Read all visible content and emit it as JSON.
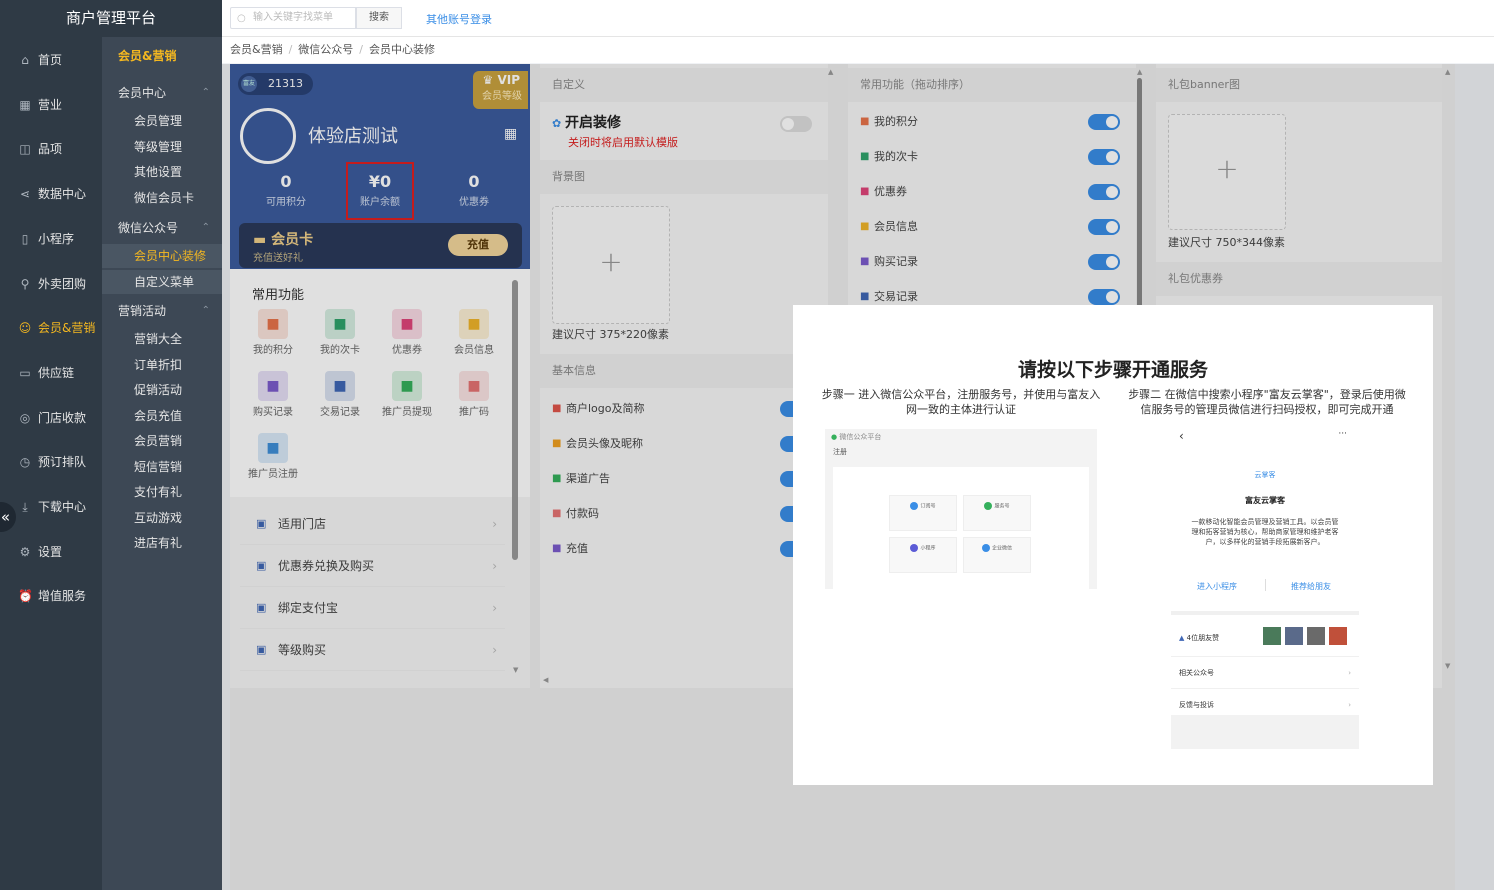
{
  "app": {
    "title": "商户管理平台"
  },
  "topbar": {
    "search_placeholder": "输入关键字找菜单",
    "search_button": "搜索",
    "other_login": "其他账号登录"
  },
  "nav_primary": [
    {
      "label": "首页",
      "icon": "home-icon"
    },
    {
      "label": "营业",
      "icon": "calendar-icon"
    },
    {
      "label": "品项",
      "icon": "bag-icon"
    },
    {
      "label": "数据中心",
      "icon": "share-icon"
    },
    {
      "label": "小程序",
      "icon": "phone-icon"
    },
    {
      "label": "外卖团购",
      "icon": "bike-icon"
    },
    {
      "label": "会员&营销",
      "icon": "user-icon",
      "active": true
    },
    {
      "label": "供应链",
      "icon": "truck-icon"
    },
    {
      "label": "门店收款",
      "icon": "coin-icon"
    },
    {
      "label": "预订排队",
      "icon": "clock-icon"
    },
    {
      "label": "下载中心",
      "icon": "download-icon"
    },
    {
      "label": "设置",
      "icon": "gear-icon"
    },
    {
      "label": "增值服务",
      "icon": "alarm-icon"
    }
  ],
  "nav_secondary": {
    "head": "会员&营销",
    "groups": [
      {
        "label": "会员中心",
        "items": [
          "会员管理",
          "等级管理",
          "其他设置",
          "微信会员卡"
        ]
      },
      {
        "label": "微信公众号",
        "items": [
          "会员中心装修",
          "自定义菜单"
        ]
      },
      {
        "label": "营销活动",
        "items": [
          "营销大全",
          "订单折扣",
          "促销活动",
          "会员充值",
          "会员营销",
          "短信营销",
          "支付有礼",
          "互动游戏",
          "进店有礼"
        ]
      }
    ]
  },
  "breadcrumb": [
    "会员&营销",
    "微信公众号",
    "会员中心装修"
  ],
  "phone": {
    "store_id": "21313",
    "logo_text": "富友",
    "vip_label": "VIP",
    "vip_sub": "会员等级",
    "shop_name": "体验店测试",
    "stats": [
      {
        "value": "0",
        "label": "可用积分"
      },
      {
        "value": "¥0",
        "label": "账户余额"
      },
      {
        "value": "0",
        "label": "优惠券"
      }
    ],
    "card_title": "会员卡",
    "card_sub": "充值送好礼",
    "recharge": "充值",
    "func_title": "常用功能",
    "functions": [
      {
        "label": "我的积分",
        "icon": "gem-icon",
        "color": "#e8734a"
      },
      {
        "label": "我的次卡",
        "icon": "card-icon",
        "color": "#2fa36b"
      },
      {
        "label": "优惠券",
        "icon": "coupon-icon",
        "color": "#e0457a"
      },
      {
        "label": "会员信息",
        "icon": "info-icon",
        "color": "#f0b429"
      },
      {
        "label": "购买记录",
        "icon": "cart-icon",
        "color": "#7b5ccc"
      },
      {
        "label": "交易记录",
        "icon": "bookmark-icon",
        "color": "#3f67b5"
      },
      {
        "label": "推广员提现",
        "icon": "wallet-icon",
        "color": "#35b05c"
      },
      {
        "label": "推广码",
        "icon": "grid-icon",
        "color": "#e57373"
      },
      {
        "label": "推广员注册",
        "icon": "users-icon",
        "color": "#3f8fd8"
      }
    ],
    "rows": [
      "适用门店",
      "优惠券兑换及购买",
      "绑定支付宝",
      "等级购买"
    ]
  },
  "col_custom": {
    "head": "自定义",
    "enable_title": "开启装修",
    "enable_note": "关闭时将启用默认模版",
    "bg_head": "背景图",
    "bg_hint": "建议尺寸 375*220像素",
    "basic_head": "基本信息",
    "basic_items": [
      {
        "label": "商户logo及简称",
        "icon": "shop-icon",
        "color": "#e0554a"
      },
      {
        "label": "会员头像及昵称",
        "icon": "user-icon",
        "color": "#f0a020"
      },
      {
        "label": "渠道广告",
        "icon": "speaker-icon",
        "color": "#35b05c"
      },
      {
        "label": "付款码",
        "icon": "grid-icon",
        "color": "#e57373"
      },
      {
        "label": "充值",
        "icon": "card-icon",
        "color": "#7b5ccc"
      }
    ]
  },
  "col_common": {
    "head": "常用功能（拖动排序）",
    "items": [
      {
        "label": "我的积分",
        "color": "#e8734a"
      },
      {
        "label": "我的次卡",
        "color": "#2fa36b"
      },
      {
        "label": "优惠券",
        "color": "#e0457a"
      },
      {
        "label": "会员信息",
        "color": "#f0b429"
      },
      {
        "label": "购买记录",
        "color": "#7b5ccc"
      },
      {
        "label": "交易记录",
        "color": "#3f67b5"
      }
    ]
  },
  "col_gift": {
    "head": "礼包banner图",
    "hint": "建议尺寸 750*344像素",
    "coupon_head": "礼包优惠券"
  },
  "modal": {
    "title": "请按以下步骤开通服务",
    "step1": "步骤一 进入微信公众平台，注册服务号，并使用与富友入网一致的主体进行认证",
    "step2": "步骤二 在微信中搜索小程序\"富友云掌客\"，登录后使用微信服务号的管理员微信进行扫码授权，即可完成开通",
    "wx_platform": "微信公众平台",
    "wx_register": "注册",
    "wx_cards": [
      "订阅号",
      "服务号",
      "小程序",
      "企业微信"
    ],
    "mp_back": "‹",
    "mp_more": "···",
    "mp_logo": "云掌客",
    "mp_name": "富友云掌客",
    "mp_desc": "一款移动化智能会员管理及营销工具。以会员管理和拓客营销为核心，帮助商家管理和维护老客户，以多样化的营销手段拓展新客户。",
    "mp_enter": "进入小程序",
    "mp_recommend": "推荐给朋友",
    "mp_likes": "4位朋友赞",
    "mp_related": "相关公众号",
    "mp_feedback": "反馈与投诉"
  }
}
